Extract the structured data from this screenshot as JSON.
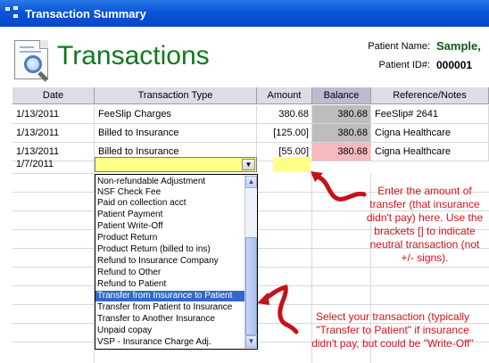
{
  "window": {
    "title": "Transaction Summary",
    "icon": "app-window-icon"
  },
  "header": {
    "title": "Transactions",
    "icon": "document-magnifier-icon",
    "patient_name_label": "Patient Name:",
    "patient_name_value": "Sample,",
    "patient_id_label": "Patient ID#:",
    "patient_id_value": "000001"
  },
  "table": {
    "columns": [
      "Date",
      "Transaction Type",
      "Amount",
      "Balance",
      "Reference/Notes"
    ],
    "rows": [
      {
        "date": "1/13/2011",
        "type": "FeeSlip Charges",
        "amount": "380.68",
        "balance": "380.68",
        "balance_status": "gray",
        "reference": "FeeSlip# 2641"
      },
      {
        "date": "1/13/2011",
        "type": "Billed to Insurance",
        "amount": "[125.00]",
        "balance": "380.68",
        "balance_status": "gray",
        "reference": "Cigna Healthcare"
      },
      {
        "date": "1/13/2011",
        "type": "Billed to Insurance",
        "amount": "[55.00]",
        "balance": "380.68",
        "balance_status": "pink",
        "reference": "Cigna Healthcare"
      }
    ],
    "editing_row": {
      "date": "1/7/2011",
      "type": "",
      "amount": ""
    }
  },
  "dropdown": {
    "items": [
      "Non-refundable Adjustment",
      "NSF Check Fee",
      "Paid on collection acct",
      "Patient Payment",
      "Patient Write-Off",
      "Product Return",
      "Product Return (billed to ins)",
      "Refund to Insurance Company",
      "Refund to Other",
      "Refund to Patient",
      "Transfer from Insurance to Patient",
      "Transfer from Patient to Insurance",
      "Transfer to Another Insurance",
      "Unpaid copay",
      "VSP - Insurance Charge Adj."
    ],
    "selected_index": 10
  },
  "annotations": {
    "amount_note": "Enter the amount of transfer (that insurance didn't pay) here. Use the brackets [] to indicate neutral transaction (not +/- signs).",
    "amount_note_lines": [
      "Enter the amount of",
      "transfer (that insurance",
      "didn't pay) here. Use the",
      "brackets [] to indicate",
      "neutral transaction (not",
      "+/- signs)."
    ],
    "type_note_lines": [
      "Select your transaction (typically",
      "\"Transfer to Patient\" if insurance",
      "didn't pay, but could be \"Write-Off\""
    ],
    "color": "#d3131a"
  },
  "colors": {
    "title_bar": "#0a56d8",
    "title_text": "#0f7a1f",
    "editing_field": "#ffff88",
    "selected_item": "#316ac5",
    "balance_gray": "#bdbdbd",
    "balance_pink": "#f6b9bd"
  }
}
